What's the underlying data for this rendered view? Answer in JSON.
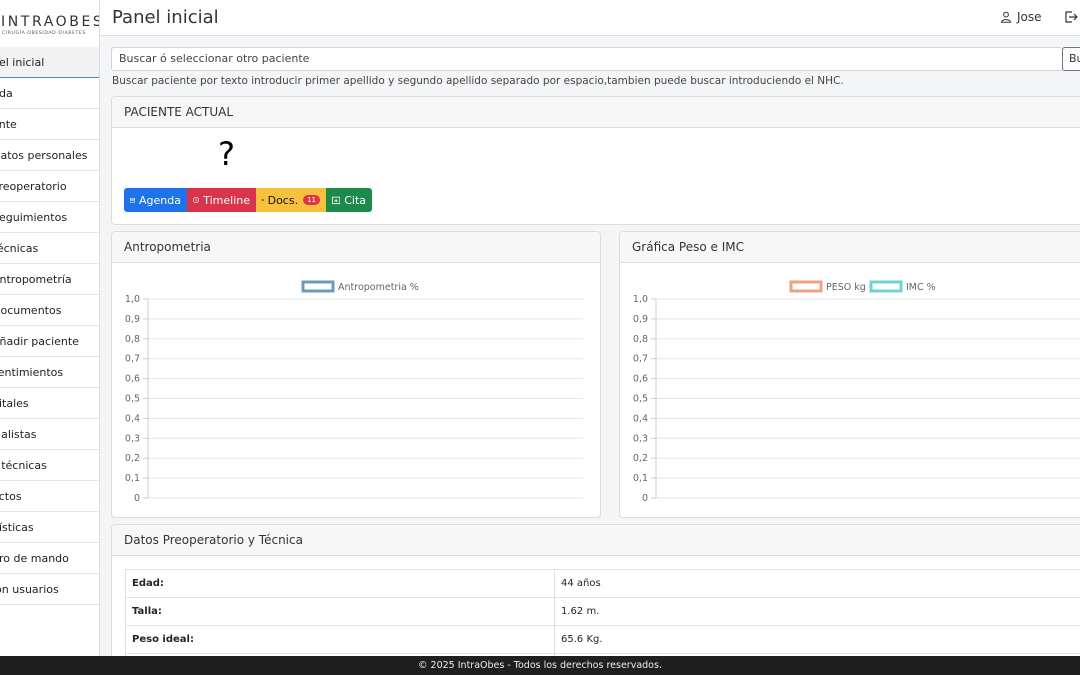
{
  "logo": {
    "name": "INTRAOBES",
    "tagline": "CIRUGÍA·OBESIDAD·DIABETES"
  },
  "sidebar": {
    "items": [
      {
        "label": "nel inicial",
        "active": true
      },
      {
        "label": "nda"
      },
      {
        "label": "ente"
      },
      {
        "label": "Datos personales"
      },
      {
        "label": "Preoperatorio"
      },
      {
        "label": "Seguimientos"
      },
      {
        "label": "Técnicas"
      },
      {
        "label": "Antropometría"
      },
      {
        "label": "Documentos"
      },
      {
        "label": "Añadir paciente"
      },
      {
        "label": "sentimientos"
      },
      {
        "label": "pitales"
      },
      {
        "label": "cialistas"
      },
      {
        "label": "s técnicas"
      },
      {
        "label": "actos"
      },
      {
        "label": "dísticas"
      },
      {
        "label": "dro de mando"
      },
      {
        "label": "ión usuarios"
      }
    ]
  },
  "header": {
    "title": "Panel inicial",
    "user": "Jose"
  },
  "search": {
    "placeholder": "Buscar ó seleccionar otro paciente",
    "button": "Bu",
    "hint": "Buscar paciente por texto introducir primer apellido y segundo apellido separado por espacio,tambien puede buscar introduciendo el NHC."
  },
  "patient": {
    "title": "PACIENTE ACTUAL",
    "name": "?",
    "buttons": {
      "agenda": "Agenda",
      "timeline": "Timeline",
      "docs": "Docs.",
      "docs_badge": "11",
      "cita": "Cita"
    }
  },
  "antropometria": {
    "title": "Antropometria"
  },
  "grafica": {
    "title": "Gráfica Peso e IMC"
  },
  "chart_data": [
    {
      "type": "line",
      "series": [
        {
          "name": "Antropometria %",
          "color": "#6b9bb8",
          "values": []
        }
      ],
      "yticks": [
        "0",
        "0,1",
        "0,2",
        "0,3",
        "0,4",
        "0,5",
        "0,6",
        "0,7",
        "0,8",
        "0,9",
        "1,0"
      ],
      "ylim": [
        0,
        1
      ],
      "grid": true,
      "legend": "top"
    },
    {
      "type": "line",
      "series": [
        {
          "name": "PESO kg",
          "color": "#f0a084",
          "values": []
        },
        {
          "name": "IMC %",
          "color": "#6ed3cf",
          "values": []
        }
      ],
      "yticks": [
        "0",
        "0,1",
        "0,2",
        "0,3",
        "0,4",
        "0,5",
        "0,6",
        "0,7",
        "0,8",
        "0,9",
        "1,0"
      ],
      "ylim": [
        0,
        1
      ],
      "grid": true,
      "legend": "top"
    }
  ],
  "datos": {
    "title": "Datos Preoperatorio y Técnica",
    "rows": [
      {
        "label": "Edad:",
        "value": "44 años"
      },
      {
        "label": "Talla:",
        "value": "1.62 m."
      },
      {
        "label": "Peso ideal:",
        "value": "65.6 Kg."
      },
      {
        "label": "",
        "value": ""
      }
    ]
  },
  "footer": "© 2025 IntraObes - Todos los derechos reservados."
}
